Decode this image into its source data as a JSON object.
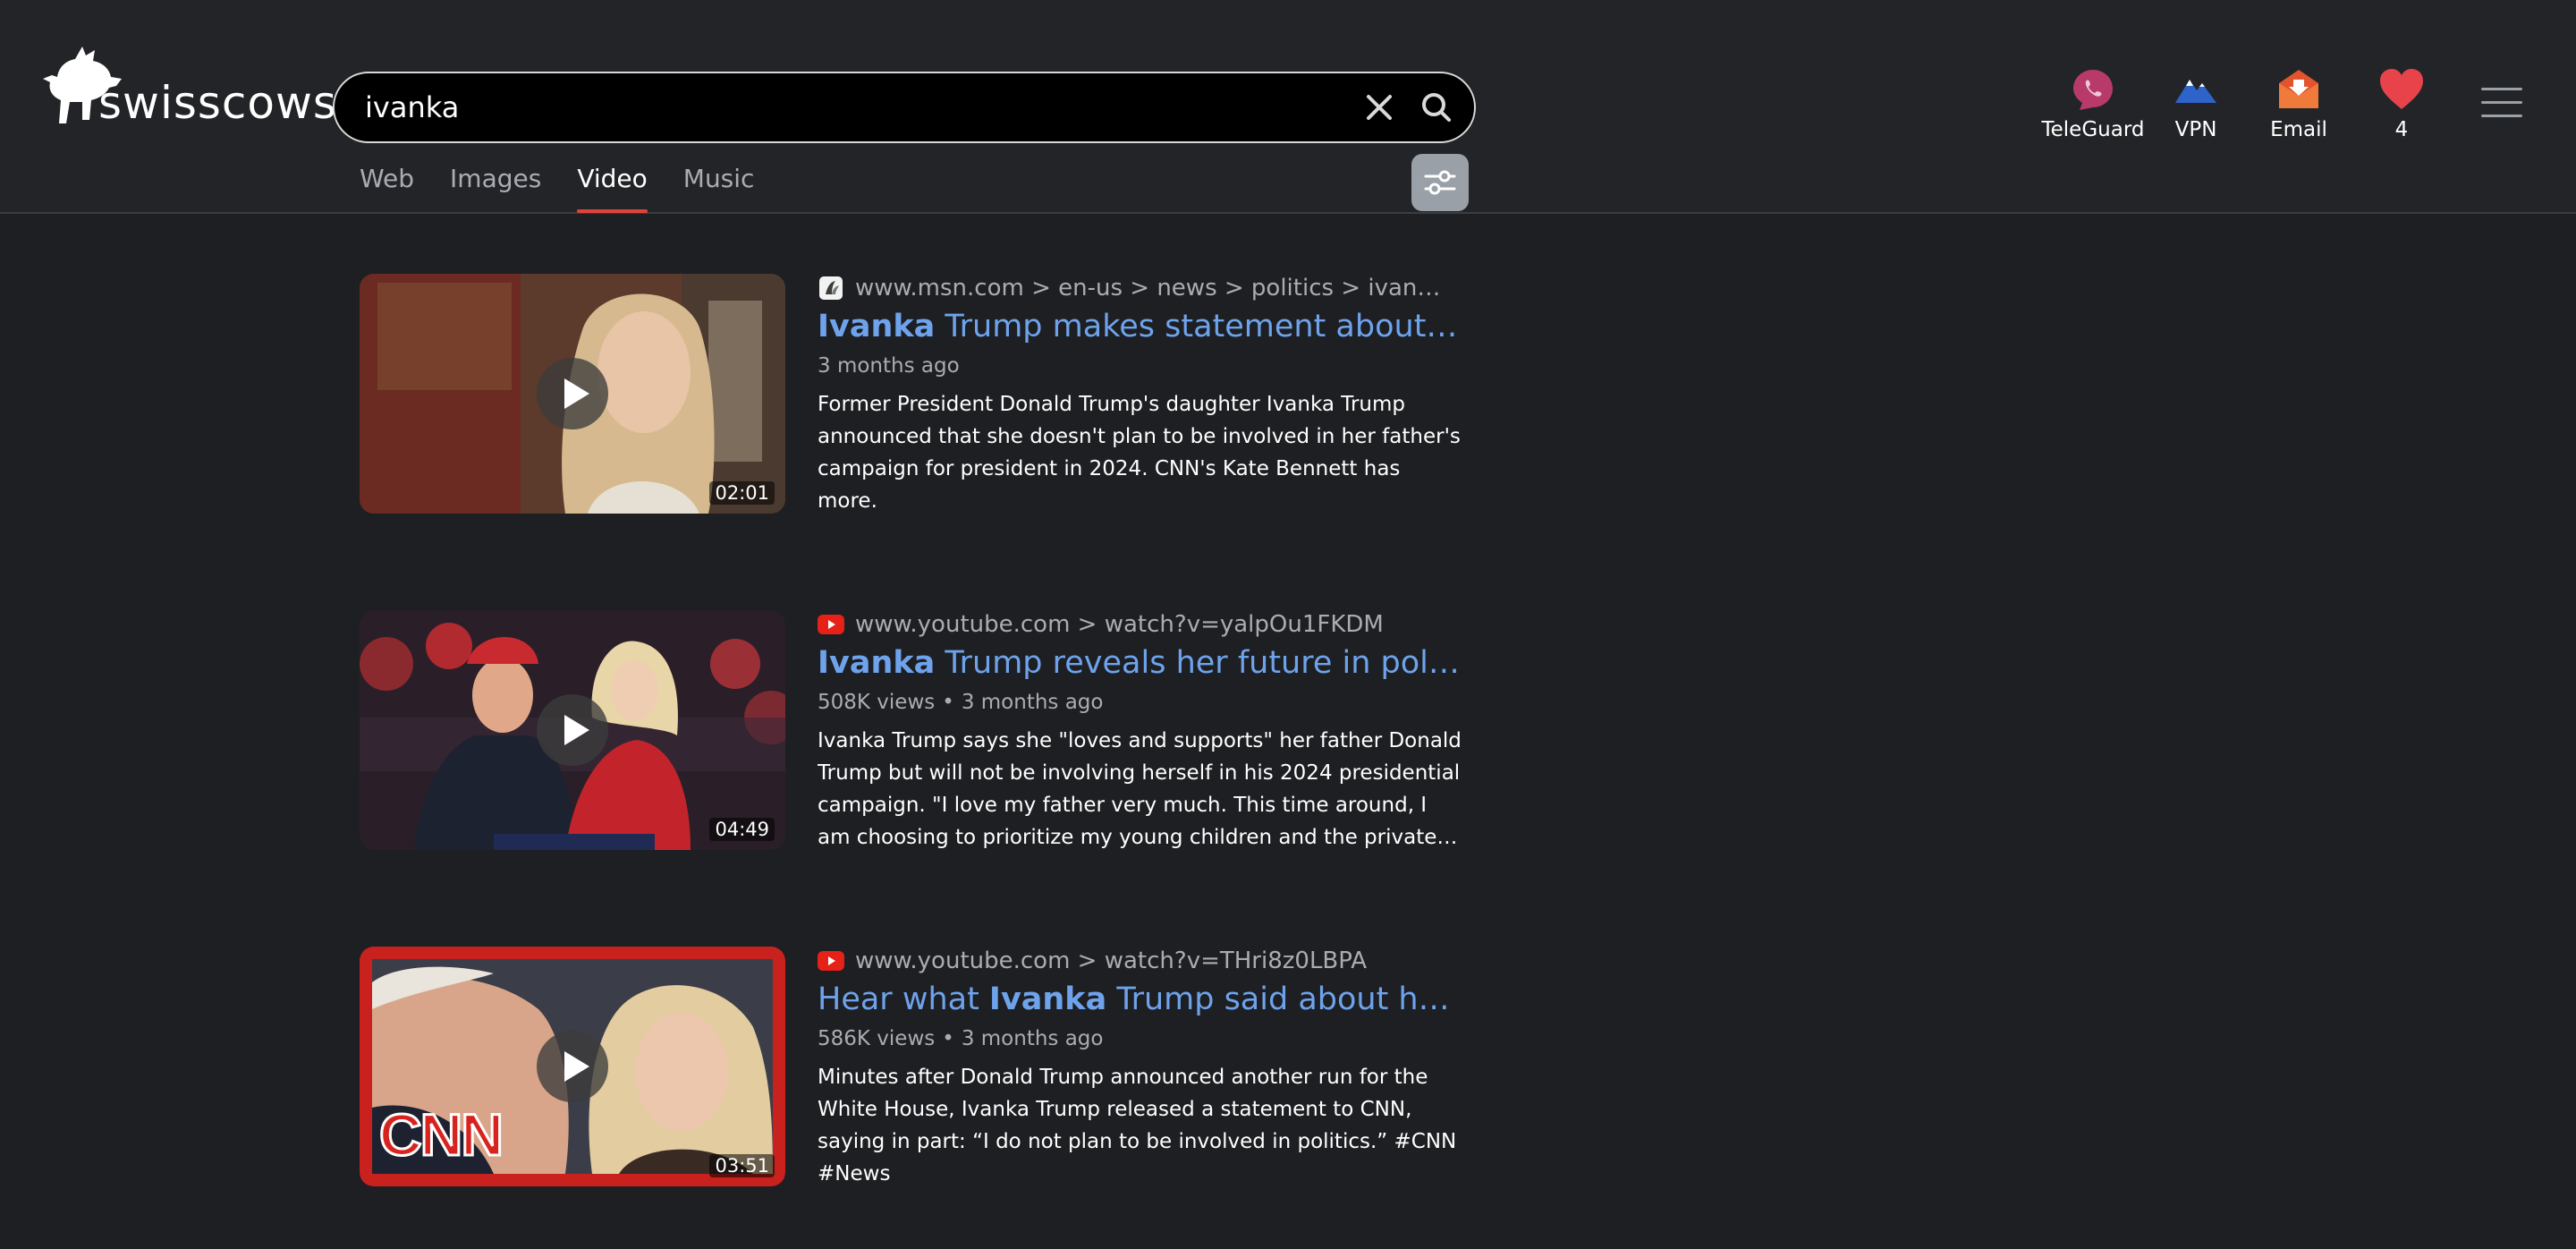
{
  "header": {
    "logo_text": "swisscows",
    "search": {
      "value": "ivanka",
      "placeholder": ""
    },
    "tabs": [
      {
        "label": "Web",
        "active": false
      },
      {
        "label": "Images",
        "active": false
      },
      {
        "label": "Video",
        "active": true
      },
      {
        "label": "Music",
        "active": false
      }
    ],
    "actions": [
      {
        "label": "TeleGuard",
        "icon": "teleguard-icon"
      },
      {
        "label": "VPN",
        "icon": "vpn-icon"
      },
      {
        "label": "Email",
        "icon": "email-icon"
      },
      {
        "label": "4",
        "icon": "heart-icon"
      }
    ]
  },
  "colors": {
    "accent": "#e0433b",
    "link": "#6ea3ec",
    "background": "#1d1f22"
  },
  "results": [
    {
      "url": "www.msn.com > en-us > news > politics > ivanka-tr...",
      "title_bold": "Ivanka",
      "title_pre": "",
      "title_post": " Trump makes statement about fat...",
      "views": "",
      "age": "3 months ago",
      "description": "Former President Donald Trump's daughter Ivanka Trump announced that she doesn't plan to be involved in her father's campaign for president in 2024. CNN's Kate Bennett has more.",
      "duration": "02:01",
      "source_icon": "msn-icon"
    },
    {
      "url": "www.youtube.com > watch?v=yalpOu1FKDM",
      "title_bold": "Ivanka",
      "title_pre": "",
      "title_post": " Trump reveals her future in politics",
      "views": "508K views",
      "age": "3 months ago",
      "description": "Ivanka Trump says she \"loves and supports\" her father Donald Trump but will not be involving herself in his 2024 presidential campaign. \"I love my father very much. This time around, I am choosing to prioritize my young children and the private life w...",
      "duration": "04:49",
      "source_icon": "youtube-icon"
    },
    {
      "url": "www.youtube.com > watch?v=THri8z0LBPA",
      "title_bold": "Ivanka",
      "title_pre": "Hear what ",
      "title_post": " Trump said about her f...",
      "views": "586K views",
      "age": "3 months ago",
      "description": "Minutes after Donald Trump announced another run for the White House, Ivanka Trump released a statement to CNN, saying in part: “I do not plan to be involved in politics.” #CNN #News",
      "duration": "03:51",
      "thumb_logo": "CNN",
      "source_icon": "youtube-icon"
    }
  ]
}
